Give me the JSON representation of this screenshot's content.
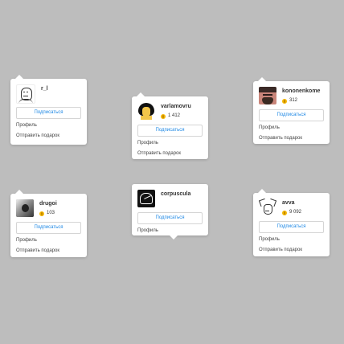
{
  "cards": [
    {
      "id": "rl",
      "username": "r_l",
      "karma": null,
      "subscribe_label": "Подписаться",
      "menu": [
        "Профиль",
        "Отправить подарок"
      ]
    },
    {
      "id": "varlamovru",
      "username": "varlamovru",
      "karma": "1 412",
      "subscribe_label": "Подписаться",
      "menu": [
        "Профиль",
        "Отправить подарок"
      ]
    },
    {
      "id": "kononenkome",
      "username": "kononenkome",
      "karma": "312",
      "subscribe_label": "Подписаться",
      "menu": [
        "Профиль",
        "Отправить подарок"
      ]
    },
    {
      "id": "drugoi",
      "username": "drugoi",
      "karma": "103",
      "subscribe_label": "Подписаться",
      "menu": [
        "Профиль",
        "Отправить подарок"
      ]
    },
    {
      "id": "corpuscula",
      "username": "corpuscula",
      "karma": null,
      "subscribe_label": "Подписаться",
      "menu": [
        "Профиль"
      ]
    },
    {
      "id": "avva",
      "username": "avva",
      "karma": "9 092",
      "subscribe_label": "Подписаться",
      "menu": [
        "Профиль",
        "Отправить подарок"
      ]
    }
  ],
  "colors": {
    "background": "#bdbdbd",
    "accent": "#1e88e5",
    "coin": "#f5b700"
  },
  "icons": {
    "karma": "coin-icon"
  }
}
